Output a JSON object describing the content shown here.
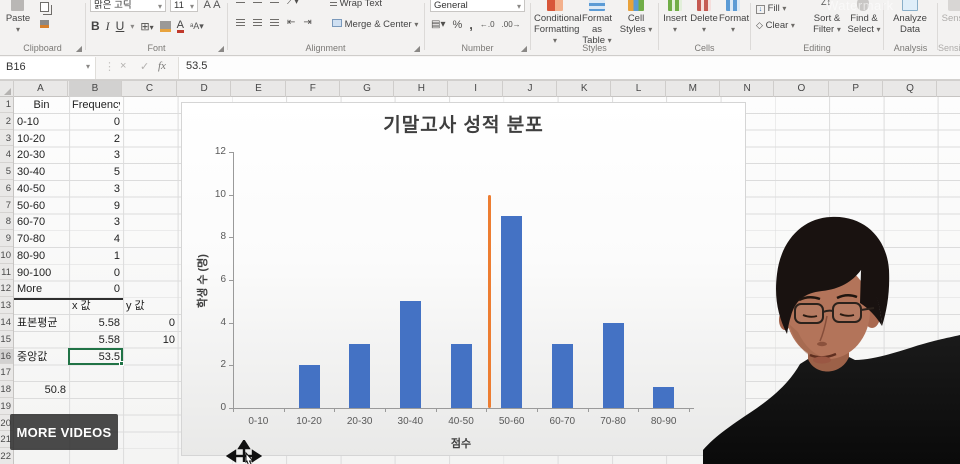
{
  "ribbon": {
    "watermark": "Watermark",
    "clipboard": {
      "label": "Clipboard",
      "paste": "Paste"
    },
    "font": {
      "label": "Font",
      "font_name": "맑은 고딕",
      "font_size": "11"
    },
    "alignment": {
      "label": "Alignment",
      "wrap_text": "Wrap Text",
      "merge_center": "Merge & Center"
    },
    "number": {
      "label": "Number",
      "format": "General"
    },
    "styles": {
      "label": "Styles",
      "buttons": [
        [
          "Conditional",
          "Formatting"
        ],
        [
          "Format as",
          "Table"
        ],
        [
          "Cell",
          "Styles"
        ]
      ]
    },
    "cells": {
      "label": "Cells",
      "buttons": [
        "Insert",
        "Delete",
        "Format"
      ]
    },
    "editing": {
      "label": "Editing",
      "fill": "Fill",
      "clear": "Clear",
      "sort": [
        "Sort &",
        "Filter"
      ],
      "find": [
        "Find &",
        "Select"
      ]
    },
    "analysis": {
      "label": "Analysis",
      "button": [
        "Analyze",
        "Data"
      ]
    },
    "sensitivity": {
      "label": "Sensitivity",
      "button": "Sensitivity"
    }
  },
  "formula_bar": {
    "name_box": "B16",
    "fx": "fx",
    "value": "53.5"
  },
  "sheet": {
    "columns": [
      "A",
      "B",
      "C",
      "D",
      "E",
      "F",
      "G",
      "H",
      "I",
      "J",
      "K",
      "L",
      "M",
      "N",
      "O",
      "P",
      "Q",
      "R"
    ],
    "selected_column": "B",
    "selected_row": 16,
    "selected_cell": "B16",
    "num_rows": 22,
    "cells": [
      {
        "r": 1,
        "c": 0,
        "v": "Bin",
        "a": "c"
      },
      {
        "r": 1,
        "c": 1,
        "v": "Frequency",
        "a": "c"
      },
      {
        "r": 2,
        "c": 0,
        "v": "0-10",
        "a": "l"
      },
      {
        "r": 2,
        "c": 1,
        "v": "0",
        "a": "r"
      },
      {
        "r": 3,
        "c": 0,
        "v": "10-20",
        "a": "l"
      },
      {
        "r": 3,
        "c": 1,
        "v": "2",
        "a": "r"
      },
      {
        "r": 4,
        "c": 0,
        "v": "20-30",
        "a": "l"
      },
      {
        "r": 4,
        "c": 1,
        "v": "3",
        "a": "r"
      },
      {
        "r": 5,
        "c": 0,
        "v": "30-40",
        "a": "l"
      },
      {
        "r": 5,
        "c": 1,
        "v": "5",
        "a": "r"
      },
      {
        "r": 6,
        "c": 0,
        "v": "40-50",
        "a": "l"
      },
      {
        "r": 6,
        "c": 1,
        "v": "3",
        "a": "r"
      },
      {
        "r": 7,
        "c": 0,
        "v": "50-60",
        "a": "l"
      },
      {
        "r": 7,
        "c": 1,
        "v": "9",
        "a": "r"
      },
      {
        "r": 8,
        "c": 0,
        "v": "60-70",
        "a": "l"
      },
      {
        "r": 8,
        "c": 1,
        "v": "3",
        "a": "r"
      },
      {
        "r": 9,
        "c": 0,
        "v": "70-80",
        "a": "l"
      },
      {
        "r": 9,
        "c": 1,
        "v": "4",
        "a": "r"
      },
      {
        "r": 10,
        "c": 0,
        "v": "80-90",
        "a": "l"
      },
      {
        "r": 10,
        "c": 1,
        "v": "1",
        "a": "r"
      },
      {
        "r": 11,
        "c": 0,
        "v": "90-100",
        "a": "l"
      },
      {
        "r": 11,
        "c": 1,
        "v": "0",
        "a": "r"
      },
      {
        "r": 12,
        "c": 0,
        "v": "More",
        "a": "l"
      },
      {
        "r": 12,
        "c": 1,
        "v": "0",
        "a": "r"
      },
      {
        "r": 13,
        "c": 1,
        "v": "x 값",
        "a": "l"
      },
      {
        "r": 13,
        "c": 2,
        "v": "y 값",
        "a": "l"
      },
      {
        "r": 14,
        "c": 0,
        "v": "표본평균",
        "a": "l"
      },
      {
        "r": 14,
        "c": 1,
        "v": "5.58",
        "a": "r"
      },
      {
        "r": 14,
        "c": 2,
        "v": "0",
        "a": "r"
      },
      {
        "r": 15,
        "c": 1,
        "v": "5.58",
        "a": "r"
      },
      {
        "r": 15,
        "c": 2,
        "v": "10",
        "a": "r"
      },
      {
        "r": 16,
        "c": 0,
        "v": "중앙값",
        "a": "l"
      },
      {
        "r": 16,
        "c": 1,
        "v": "53.5",
        "a": "r"
      },
      {
        "r": 18,
        "c": 0,
        "v": "50.8",
        "a": "r"
      }
    ]
  },
  "chart_data": {
    "type": "bar",
    "title": "기말고사 성적 분포",
    "categories": [
      "0-10",
      "10-20",
      "20-30",
      "30-40",
      "40-50",
      "50-60",
      "60-70",
      "70-80",
      "80-90"
    ],
    "values": [
      0,
      2,
      3,
      5,
      3,
      9,
      3,
      4,
      1
    ],
    "xlabel": "점수",
    "ylabel": "학생 수 (명)",
    "ylim": [
      0,
      12
    ],
    "yticks": [
      0,
      2,
      4,
      6,
      8,
      10,
      12
    ],
    "bar_color": "#4472c4",
    "grid": "off",
    "legend": "none",
    "median_line": {
      "label": "중앙값",
      "x_value": 53.5,
      "series_x": 5.58,
      "y_from": 0,
      "y_to": 10,
      "plot_fraction": 0.563,
      "color": "#ED7D31"
    }
  },
  "overlays": {
    "more_videos": "MORE VIDEOS"
  }
}
